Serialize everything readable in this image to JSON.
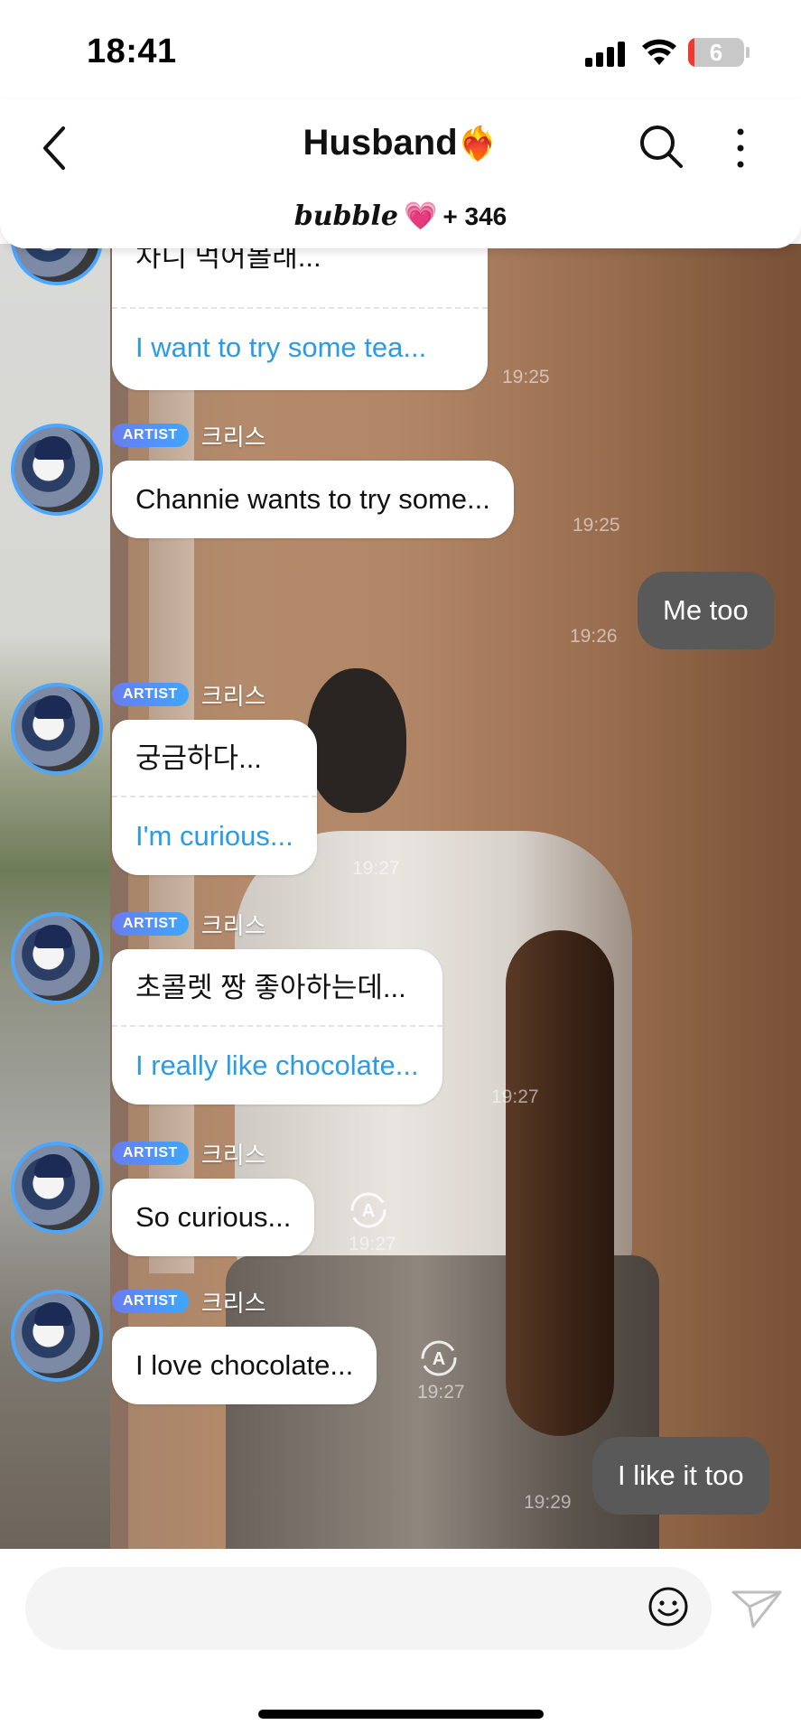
{
  "status_bar": {
    "time": "18:41",
    "battery": "6",
    "battery_level": 0.06
  },
  "header": {
    "title": "Husband",
    "title_emoji": "❤️‍🔥",
    "brand": "bubble",
    "heart": "💗",
    "count": "+ 346"
  },
  "colors": {
    "accent_blue": "#3da7ff",
    "translation_text": "#2a9be6",
    "my_bubble": "#595959"
  },
  "messages": [
    {
      "korean": "차니 먹어볼래...",
      "english": "I want to try some tea...",
      "time": "19:25"
    },
    {
      "badge": "ARTIST",
      "sender": "크리스",
      "text": "Channie wants to try some...",
      "time": "19:25"
    },
    {
      "text": "Me too",
      "time": "19:26"
    },
    {
      "badge": "ARTIST",
      "sender": "크리스",
      "korean": "궁금하다...",
      "english": "I'm curious...",
      "time": "19:27"
    },
    {
      "badge": "ARTIST",
      "sender": "크리스",
      "korean": "초콜렛 짱 좋아하는데...",
      "english": "I really like chocolate...",
      "time": "19:27"
    },
    {
      "badge": "ARTIST",
      "sender": "크리스",
      "text": "So curious...",
      "time": "19:27"
    },
    {
      "badge": "ARTIST",
      "sender": "크리스",
      "text": "I love chocolate...",
      "time": "19:27"
    },
    {
      "text": "I like it too",
      "time": "19:29"
    }
  ],
  "icons": {
    "back": "chevron-left-icon",
    "search": "search-icon",
    "more": "more-vertical-icon",
    "translate": "translate-icon",
    "emoji": "emoji-icon",
    "send": "send-icon"
  }
}
